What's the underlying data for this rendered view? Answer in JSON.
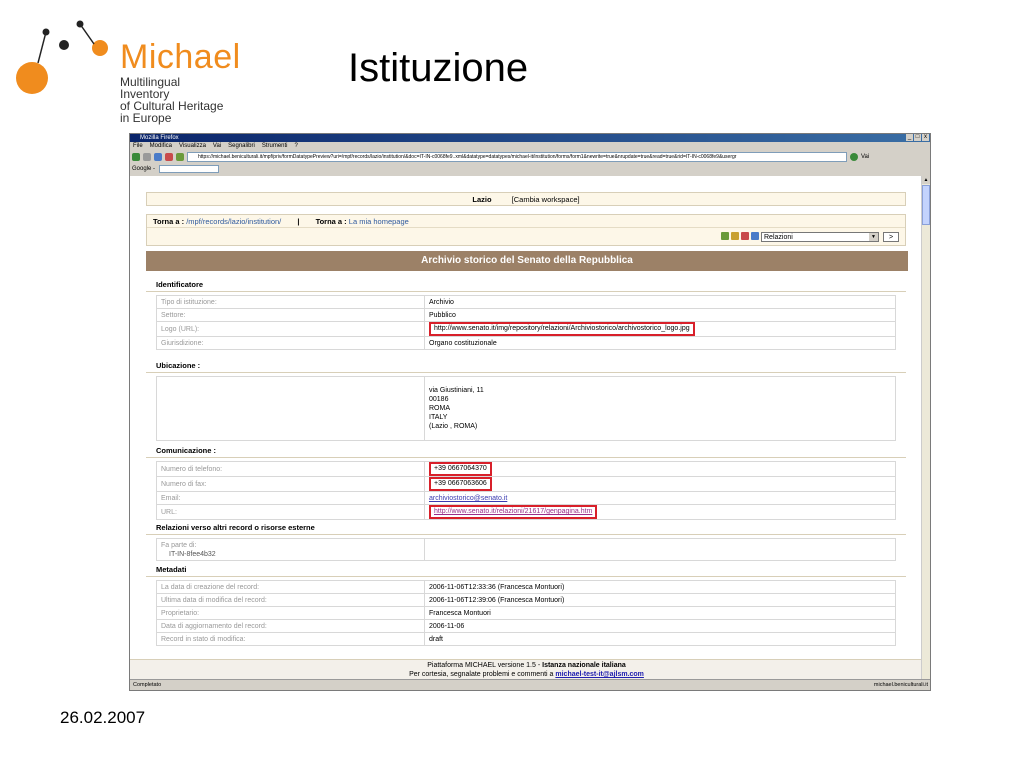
{
  "logo": {
    "title": "Michael",
    "subtitle_lines": [
      "Multilingual",
      "Inventory",
      "of Cultural Heritage",
      "in Europe"
    ]
  },
  "slide": {
    "title": "Istituzione",
    "date": "26.02.2007"
  },
  "browser": {
    "window_title": "Mozilla Firefox",
    "window_buttons": [
      "_",
      "□",
      "x"
    ],
    "menu": [
      "File",
      "Modifica",
      "Visualizza",
      "Vai",
      "Segnalibri",
      "Strumenti",
      "?"
    ],
    "url": "https://michael.beniculturali.it/mpf/priv/formDatatypePreview?uri=/mpf/records/lazio/institution/&doc=IT-IN-c0068fe9..xml&datatype=datatypes/michael-it/institution/forms/form1&newrite=true&nrupdate=true&read=true&rid=IT-IN-c0068fe9&usergr",
    "go_label": "Vai",
    "google_label": "Google -",
    "status_left": "Completato",
    "status_right": "michael.beniculturali.it"
  },
  "page": {
    "workspace": {
      "region": "Lazio",
      "change": "[Cambia workspace]"
    },
    "nav": {
      "back1_label": "Torna a :",
      "back1_link": "/mpf/records/lazio/institution/",
      "separator": "|",
      "back2_label": "Torna a :",
      "back2_link": "La mia homepage",
      "select_value": "Relazioni",
      "go_button": ">"
    },
    "heading": "Archivio storico del Senato della Repubblica",
    "identificatore": {
      "title": "Identificatore",
      "rows": [
        {
          "label": "Tipo di istituzione:",
          "value": "Archivio"
        },
        {
          "label": "Settore:",
          "value": "Pubblico"
        },
        {
          "label": "Logo (URL):",
          "value": "http://www.senato.it/img/repository/relazioni/Archiviostorico/archivostorico_logo.jpg"
        },
        {
          "label": "Giurisdizione:",
          "value": "Organo costituzionale"
        }
      ]
    },
    "ubicazione": {
      "title": "Ubicazione :",
      "lines": [
        "via Giustiniani, 11",
        "00186",
        "ROMA",
        "ITALY",
        "(Lazio , ROMA)"
      ]
    },
    "comunicazione": {
      "title": "Comunicazione :",
      "rows": [
        {
          "label": "Numero di telefono:",
          "value": "+39 0667064370"
        },
        {
          "label": "Numero di fax:",
          "value": "+39 0667063606"
        },
        {
          "label": "Email:",
          "value": "archiviostorico@senato.it"
        },
        {
          "label": "URL:",
          "value": "http://www.senato.it/relazioni/21617/genpagina.htm"
        }
      ]
    },
    "relazioni": {
      "title": "Relazioni verso altri record o risorse esterne",
      "label": "Fa parte di:",
      "value": "IT-IN-8fee4b32"
    },
    "metadati": {
      "title": "Metadati",
      "rows": [
        {
          "label": "La data di creazione del record:",
          "value": "2006-11-06T12:33:36 (Francesca Montuori)"
        },
        {
          "label": "Ultima data di modifica del record:",
          "value": "2006-11-06T12:39:06 (Francesca Montuori)"
        },
        {
          "label": "Proprietario:",
          "value": "Francesca Montuori"
        },
        {
          "label": "Data di aggiornamento del record:",
          "value": "2006-11-06"
        },
        {
          "label": "Record in stato di modifica:",
          "value": "draft"
        }
      ]
    },
    "footer": {
      "line1_prefix": "Piattaforma MICHAEL versione 1.5 -",
      "line1_bold": "Istanza nazionale italiana",
      "line2_prefix": "Per cortesia, segnalate problemi e commenti a",
      "email": "michael-test-it@ajlsm.com"
    }
  },
  "colors": {
    "logo_orange": "#f08c1e",
    "heading_bar": "#9c8167",
    "highlight_red": "#d8202a",
    "panel_bg": "#fdf7e8"
  }
}
